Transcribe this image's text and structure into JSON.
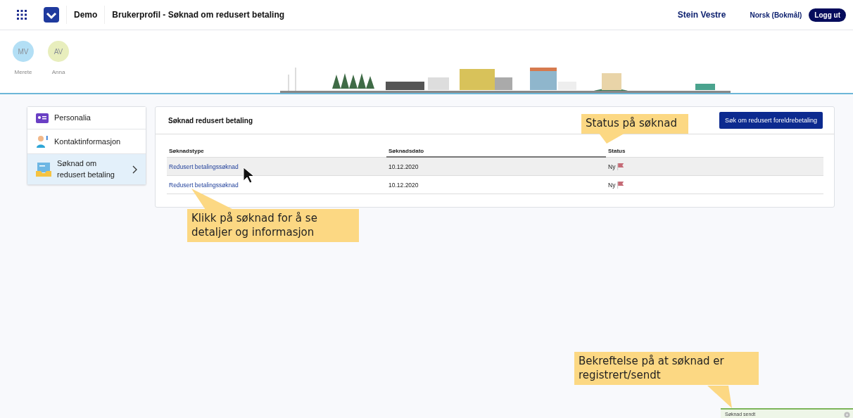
{
  "header": {
    "app": "Demo",
    "title": "Brukerprofil - Søknad om redusert betaling",
    "user": "Stein Vestre",
    "language": "Norsk (Bokmål)",
    "logout": "Logg ut"
  },
  "family": [
    {
      "initials": "MV",
      "name": "Merete",
      "color": "#b3dff5"
    },
    {
      "initials": "AV",
      "name": "Anna",
      "color": "#e8eebd"
    }
  ],
  "sidebar": {
    "items": [
      {
        "label": "Personalia",
        "kind": "card",
        "selected": false
      },
      {
        "label": "Kontaktinformasjon",
        "kind": "person",
        "selected": false
      },
      {
        "label": "Søknad om redusert betaling",
        "kind": "inbox",
        "selected": true
      }
    ]
  },
  "card": {
    "title": "Søknad redusert betaling",
    "button": "Søk om redusert foreldrebetaling",
    "columns": [
      "Søknadstype",
      "Søknadsdato",
      "Status"
    ],
    "rows": [
      {
        "type": "Redusert betalingssøknad",
        "date": "10.12.2020",
        "status": "Ny",
        "selected": true
      },
      {
        "type": "Redusert betalingssøknad",
        "date": "10.12.2020",
        "status": "Ny",
        "selected": false
      }
    ]
  },
  "callouts": [
    {
      "text": "Status på søknad"
    },
    {
      "text": "Klikk på søknad for å se detaljer og informasjon"
    },
    {
      "text": "Bekreftelse på at søknad er registrert/sendt"
    }
  ],
  "toast": {
    "text": "Søknad sendt"
  }
}
